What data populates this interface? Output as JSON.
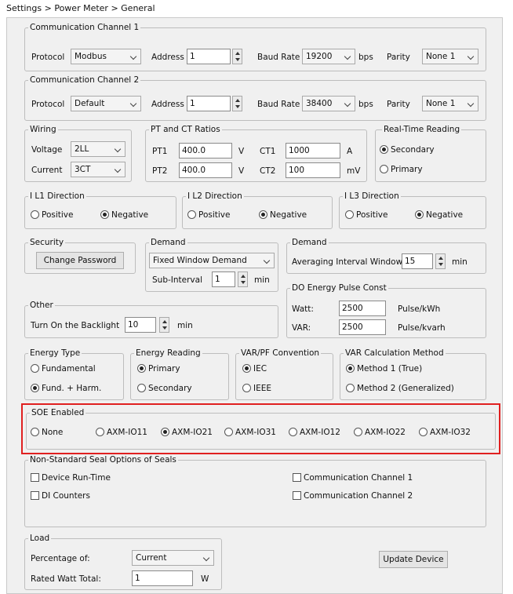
{
  "breadcrumb": "Settings > Power Meter > General",
  "comm1": {
    "title": "Communication Channel 1",
    "protocol_label": "Protocol",
    "protocol": "Modbus",
    "address_label": "Address",
    "address": "1",
    "baud_label": "Baud Rate",
    "baud": "19200",
    "bps": "bps",
    "parity_label": "Parity",
    "parity": "None 1"
  },
  "comm2": {
    "title": "Communication Channel 2",
    "protocol_label": "Protocol",
    "protocol": "Default",
    "address_label": "Address",
    "address": "1",
    "baud_label": "Baud Rate",
    "baud": "38400",
    "bps": "bps",
    "parity_label": "Parity",
    "parity": "None 1"
  },
  "wiring": {
    "title": "Wiring",
    "voltage_label": "Voltage",
    "voltage": "2LL",
    "current_label": "Current",
    "current": "3CT"
  },
  "ptct": {
    "title": "PT and CT Ratios",
    "pt1_label": "PT1",
    "pt1": "400.0",
    "pt1_unit": "V",
    "pt2_label": "PT2",
    "pt2": "400.0",
    "pt2_unit": "V",
    "ct1_label": "CT1",
    "ct1": "1000",
    "ct1_unit": "A",
    "ct2_label": "CT2",
    "ct2": "100",
    "ct2_unit": "mV"
  },
  "realtime": {
    "title": "Real-Time Reading",
    "secondary": "Secondary",
    "primary": "Primary",
    "selected": "secondary"
  },
  "dir1": {
    "title": "I L1 Direction",
    "positive": "Positive",
    "negative": "Negative"
  },
  "dir2": {
    "title": "I L2 Direction",
    "positive": "Positive",
    "negative": "Negative"
  },
  "dir3": {
    "title": "I L3 Direction",
    "positive": "Positive",
    "negative": "Negative"
  },
  "security": {
    "title": "Security",
    "change_password": "Change Password"
  },
  "demand": {
    "title": "Demand",
    "type": "Fixed Window Demand",
    "sub_interval_label": "Sub-Interval",
    "sub_interval": "1",
    "unit": "min"
  },
  "demand2": {
    "title": "Demand",
    "avg_label": "Averaging Interval Window",
    "avg": "15",
    "unit": "min"
  },
  "pulse": {
    "title": "DO Energy Pulse Const",
    "watt_label": "Watt:",
    "watt": "2500",
    "watt_unit": "Pulse/kWh",
    "var_label": "VAR:",
    "var": "2500",
    "var_unit": "Pulse/kvarh"
  },
  "other": {
    "title": "Other",
    "backlight_label": "Turn On the Backlight",
    "backlight": "10",
    "unit": "min"
  },
  "energy_type": {
    "title": "Energy Type",
    "fundamental": "Fundamental",
    "fund_harm": "Fund. + Harm."
  },
  "energy_reading": {
    "title": "Energy Reading",
    "primary": "Primary",
    "secondary": "Secondary"
  },
  "varpf": {
    "title": "VAR/PF Convention",
    "iec": "IEC",
    "ieee": "IEEE"
  },
  "varcalc": {
    "title": "VAR Calculation Method",
    "m1": "Method 1 (True)",
    "m2": "Method 2 (Generalized)"
  },
  "soe": {
    "title": "SOE Enabled",
    "options": [
      "None",
      "AXM-IO11",
      "AXM-IO21",
      "AXM-IO31",
      "AXM-IO12",
      "AXM-IO22",
      "AXM-IO32"
    ],
    "selected": "AXM-IO21",
    "highlight_color": "#e02020"
  },
  "seals": {
    "title": "Non-Standard Seal Options of Seals",
    "device_runtime": "Device Run-Time",
    "di_counters": "DI Counters",
    "comm1": "Communication Channel 1",
    "comm2": "Communication Channel 2"
  },
  "load": {
    "title": "Load",
    "percentage_label": "Percentage of:",
    "percentage": "Current",
    "rated_label": "Rated Watt Total:",
    "rated": "1",
    "rated_unit": "W"
  },
  "update_device": "Update Device"
}
